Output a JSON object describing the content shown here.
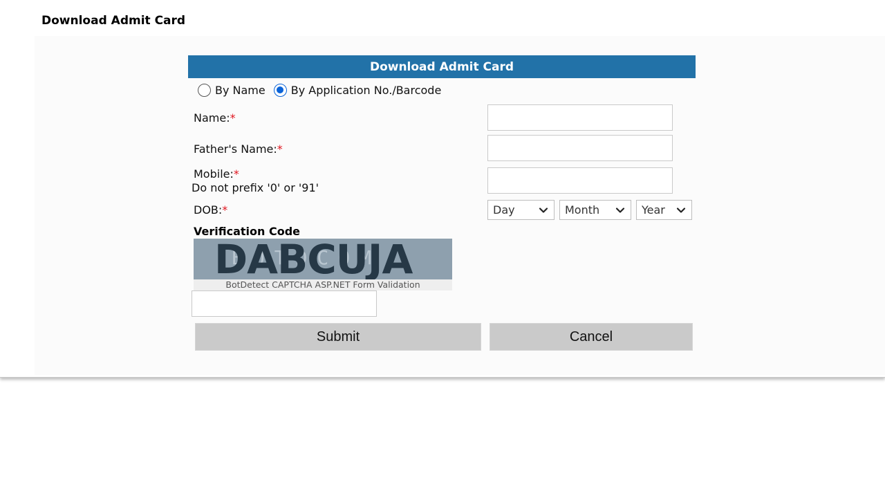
{
  "page": {
    "title": "Download Admit Card"
  },
  "form": {
    "header": "Download Admit Card",
    "search_mode": {
      "options": [
        {
          "label": "By Name",
          "selected": false
        },
        {
          "label": "By Application No./Barcode",
          "selected": true
        }
      ]
    },
    "fields": {
      "name": {
        "label": "Name:",
        "required_mark": "*",
        "value": ""
      },
      "father_name": {
        "label": "Father's Name:",
        "required_mark": "*",
        "value": ""
      },
      "mobile": {
        "label": "Mobile:",
        "required_mark": "*",
        "hint": "Do not prefix '0' or '91'",
        "value": ""
      },
      "dob": {
        "label": "DOB:",
        "required_mark": "*",
        "day": "Day",
        "month": "Month",
        "year": "Year"
      }
    },
    "verification": {
      "title": "Verification Code",
      "captcha_text": "DABCUJA",
      "captcha_caption": "BotDetect CAPTCHA ASP.NET Form Validation",
      "input_value": ""
    },
    "buttons": {
      "submit": "Submit",
      "cancel": "Cancel"
    }
  },
  "colors": {
    "header_bg": "#2272a8",
    "required": "#e0141e",
    "radio_selected": "#0a63d8",
    "button_bg": "#cacaca"
  }
}
